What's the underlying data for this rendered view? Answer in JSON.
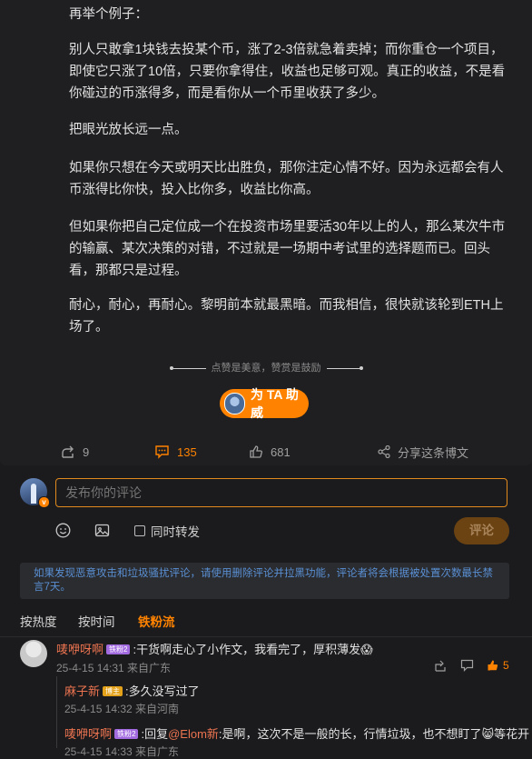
{
  "article": {
    "paragraphs": [
      "再举个例子：",
      "别人只敢拿1块钱去投某个币，涨了2-3倍就急着卖掉；而你重仓一个项目，即使它只涨了10倍，只要你拿得住，收益也足够可观。真正的收益，不是看你碰过的币涨得多，而是看你从一个币里收获了多少。",
      "把眼光放长远一点。",
      "如果你只想在今天或明天比出胜负，那你注定心情不好。因为永远都会有人币涨得比你快，投入比你多，收益比你高。",
      "但如果你把自己定位成一个在投资市场里要活30年以上的人，那么某次牛市的输赢、某次决策的对错，不过就是一场期中考试里的选择题而已。回头看，那都只是过程。",
      "耐心，耐心，再耐心。黎明前本就最黑暗。而我相信，很快就该轮到ETH上场了。"
    ],
    "reward_hint": "点赞是美意，赞赏是鼓励",
    "support_button": "为 TA 助威"
  },
  "actions": {
    "repost_count": "9",
    "comment_count": "135",
    "like_count": "681",
    "share_label": "分享这条博文"
  },
  "compose": {
    "placeholder": "发布你的评论",
    "repost_label": "同时转发",
    "submit_label": "评论",
    "avatar_badge": "v"
  },
  "notice": "如果发现恶意攻击和垃圾骚扰评论，请使用删除评论并拉黑功能，评论者将会根据被处置次数最长禁言7天。",
  "tabs": [
    "按热度",
    "按时间",
    "铁粉流"
  ],
  "comments": [
    {
      "user": "唛咿呀啊",
      "badge": "铁粉2",
      "text": "干货啊走心了小作文，我看完了，厚积薄发",
      "emoji": "😱",
      "time": "25-4-15 14:31 来自广东",
      "likes": "5"
    }
  ],
  "replies": [
    {
      "user": "麻子新",
      "badge": "博主",
      "text": "多久没写过了",
      "time": "25-4-15 14:32 来自河南"
    },
    {
      "user": "唛咿呀啊",
      "badge": "铁粉2",
      "prefix": ":回复",
      "mention": "@Elom新",
      "text": ":是啊，这次不是一般的长，行情垃圾，也不想盯了",
      "emoji": "😸",
      "suffix": "等花开",
      "time": "25-4-15 14:33 来自广东"
    }
  ],
  "colors": {
    "accent": "#ff8200",
    "username": "#eb7350",
    "notice_text": "#5a8fd3",
    "background": "#1b1b1d"
  }
}
